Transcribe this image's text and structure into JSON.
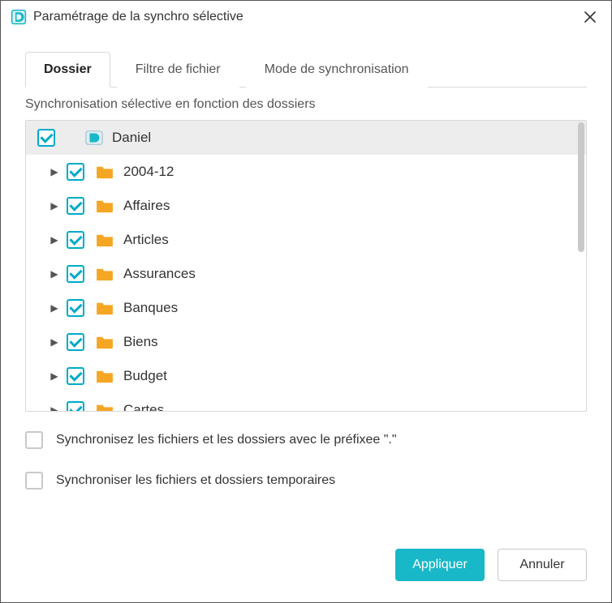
{
  "window": {
    "title": "Paramétrage de la synchro sélective"
  },
  "tabs": [
    {
      "label": "Dossier",
      "active": true
    },
    {
      "label": "Filtre de fichier",
      "active": false
    },
    {
      "label": "Mode de synchronisation",
      "active": false
    }
  ],
  "subtitle": "Synchronisation sélective en fonction des dossiers",
  "tree": {
    "root": {
      "label": "Daniel",
      "checked": true
    },
    "children": [
      {
        "label": "2004-12",
        "checked": true
      },
      {
        "label": "Affaires",
        "checked": true
      },
      {
        "label": "Articles",
        "checked": true
      },
      {
        "label": "Assurances",
        "checked": true
      },
      {
        "label": "Banques",
        "checked": true
      },
      {
        "label": "Biens",
        "checked": true
      },
      {
        "label": "Budget",
        "checked": true
      },
      {
        "label": "Cartes",
        "checked": true
      }
    ]
  },
  "options": {
    "sync_prefix_label": "Synchronisez les fichiers et les dossiers avec le préfixee \".\"",
    "sync_prefix_checked": false,
    "sync_temp_label": "Synchroniser les fichiers et dossiers temporaires",
    "sync_temp_checked": false
  },
  "buttons": {
    "apply": "Appliquer",
    "cancel": "Annuler"
  }
}
